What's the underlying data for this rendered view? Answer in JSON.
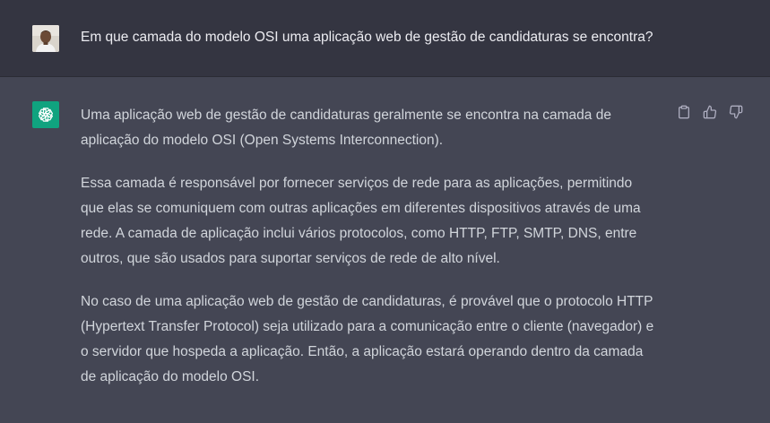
{
  "user_message": {
    "text": "Em que camada do modelo OSI uma aplicação web de gestão de candidaturas se encontra?",
    "avatar": "user-photo"
  },
  "assistant_message": {
    "avatar": "openai-logo-icon",
    "paragraphs": [
      "Uma aplicação web de gestão de candidaturas geralmente se encontra na camada de aplicação do modelo OSI (Open Systems Interconnection).",
      "Essa camada é responsável por fornecer serviços de rede para as aplicações, permitindo que elas se comuniquem com outras aplicações em diferentes dispositivos através de uma rede. A camada de aplicação inclui vários protocolos, como HTTP, FTP, SMTP, DNS, entre outros, que são usados para suportar serviços de rede de alto nível.",
      "No caso de uma aplicação web de gestão de candidaturas, é provável que o protocolo HTTP (Hypertext Transfer Protocol) seja utilizado para a comunicação entre o cliente (navegador) e o servidor que hospeda a aplicação. Então, a aplicação estará operando dentro da camada de aplicação do modelo OSI."
    ],
    "actions": [
      "clipboard-icon",
      "thumbs-up-icon",
      "thumbs-down-icon"
    ]
  },
  "colors": {
    "user_bg": "#343541",
    "assistant_bg": "#444654",
    "brand_green": "#10a37f",
    "text": "#d1d5db",
    "icon": "#acacbe"
  }
}
